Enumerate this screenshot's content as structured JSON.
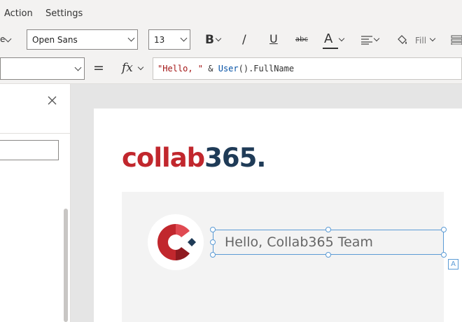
{
  "menu": {
    "items": [
      "Action",
      "Settings"
    ]
  },
  "toolbar": {
    "font_value": "Open Sans",
    "size_value": "13",
    "bold_label": "B",
    "italic_label": "/",
    "underline_label": "U",
    "strike_label": "abc",
    "font_color_label": "A",
    "fill_label": "Fill",
    "partial_left_label": "e"
  },
  "formula": {
    "equals_label": "=",
    "fx_label": "fx",
    "part_string": "\"Hello, \"",
    "part_amp": " & ",
    "part_fn": "User",
    "part_rest": "().FullName"
  },
  "app": {
    "logo_text_1": "collab",
    "logo_text_2": "365",
    "greeting": "Hello, Collab365 Team",
    "label_badge": "A"
  },
  "colors": {
    "brand_red": "#c1272d",
    "brand_navy": "#1f3b57",
    "selection": "#5b9bd5"
  }
}
